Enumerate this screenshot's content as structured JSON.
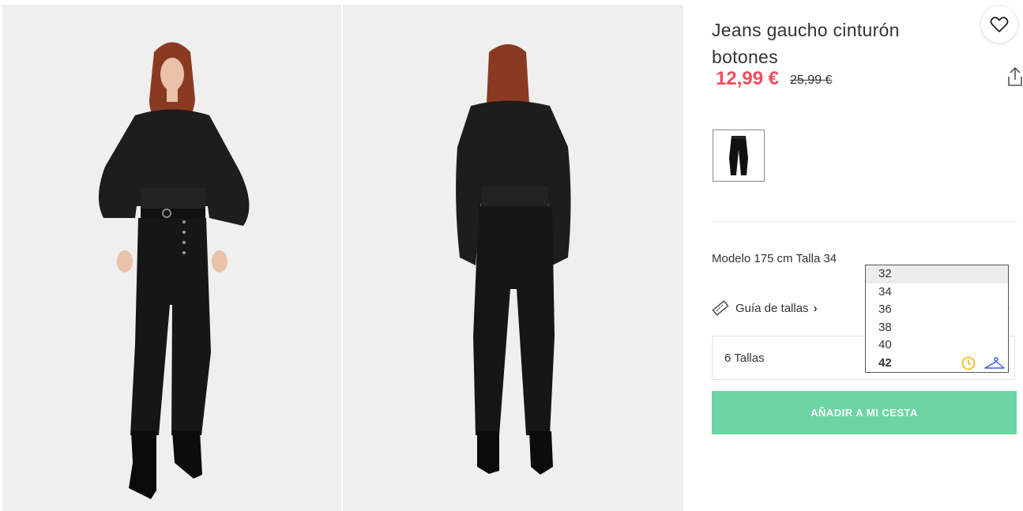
{
  "product": {
    "title": "Jeans gaucho cinturón botones",
    "price_current": "12,99 €",
    "price_original": "25,99 €",
    "model_info": "Modelo 175 cm Talla 34",
    "size_guide_label": "Guía de tallas",
    "size_selector_label": "6 Tallas",
    "sizes": [
      "32",
      "34",
      "36",
      "38",
      "40",
      "42"
    ],
    "highlighted_size": "32",
    "add_to_cart_label": "AÑADIR A MI CESTA"
  },
  "colors": {
    "price_accent": "#f04e5e",
    "cta_background": "#6dd5a3",
    "clock_icon": "#f2b705",
    "hanger_icon": "#3b5bdb"
  },
  "images": [
    {
      "name": "product-photo-front",
      "icon": "model-front-view"
    },
    {
      "name": "product-photo-back",
      "icon": "model-back-view"
    }
  ]
}
